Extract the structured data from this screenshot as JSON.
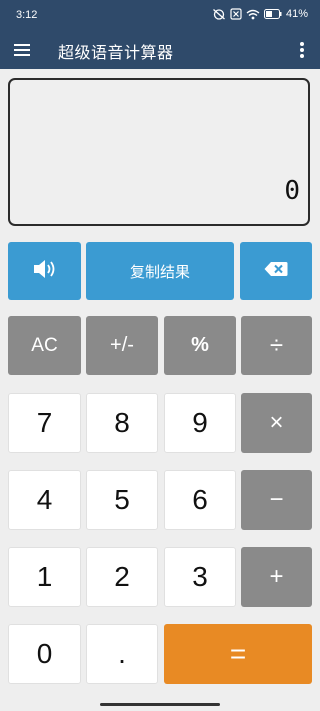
{
  "status": {
    "time": "3:12",
    "battery": "41%",
    "icons": [
      "alarm-off-icon",
      "sim-off-icon",
      "wifi-icon",
      "battery-icon"
    ]
  },
  "app": {
    "title": "超级语音计算器",
    "menu_icon": "hamburger-menu-icon",
    "more_icon": "more-vert-icon"
  },
  "display": {
    "value": "0"
  },
  "controls": {
    "speaker_icon": "speaker-icon",
    "copy_label": "复制结果",
    "backspace_icon": "backspace-icon"
  },
  "keys": {
    "ac": "AC",
    "sign": "+/-",
    "percent": "%",
    "divide": "÷",
    "multiply": "×",
    "minus": "−",
    "plus": "+",
    "equals": "=",
    "dot": ".",
    "d0": "0",
    "d1": "1",
    "d2": "2",
    "d3": "3",
    "d4": "4",
    "d5": "5",
    "d6": "6",
    "d7": "7",
    "d8": "8",
    "d9": "9"
  },
  "colors": {
    "appbar": "#2f4a6a",
    "blue": "#3b9bd2",
    "operator_gray": "#8a8a8a",
    "equals_orange": "#e88a24",
    "background": "#eeeeee"
  }
}
